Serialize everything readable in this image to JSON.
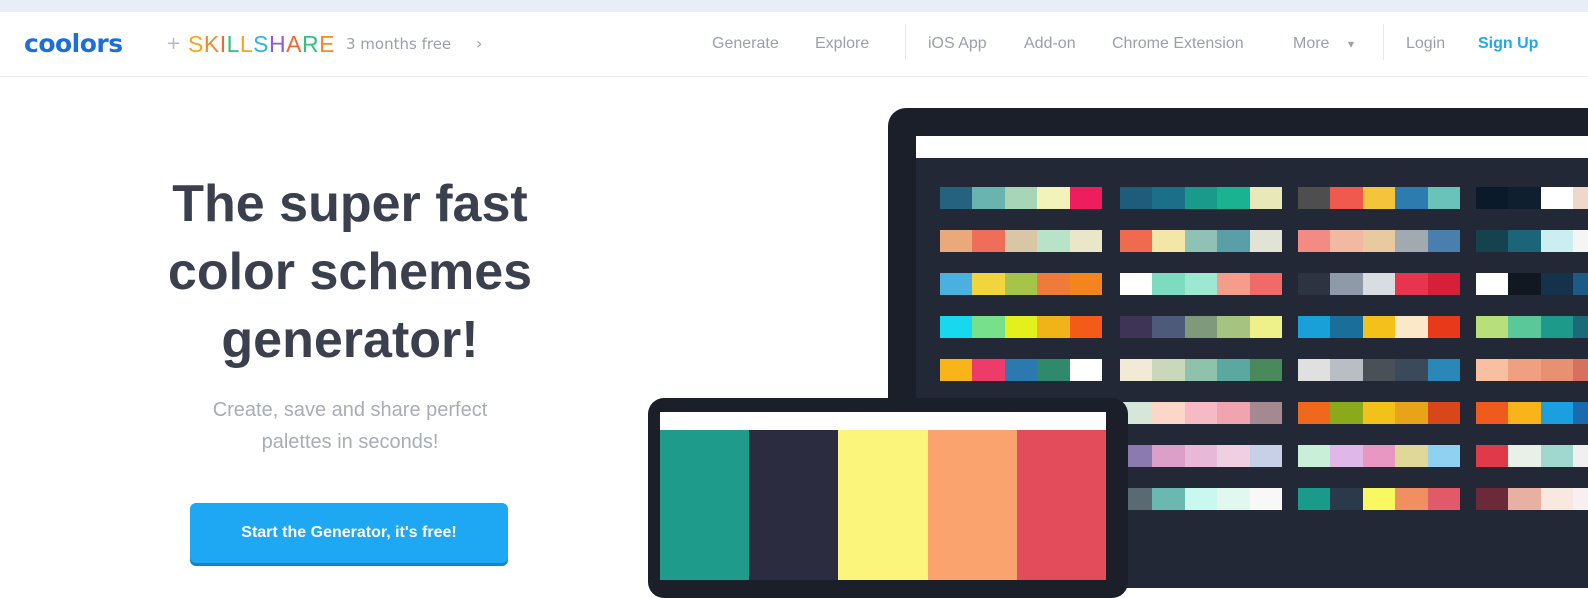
{
  "nav": {
    "logo": "coolors",
    "logo_color": "#1c6fd8",
    "plus": "+",
    "partner": {
      "letters": [
        "S",
        "K",
        "I",
        "L",
        "L",
        "S",
        "H",
        "A",
        "R",
        "E"
      ],
      "colors": [
        "#f7a51c",
        "#f48a26",
        "#f0682c",
        "#2ec47a",
        "#f7a51c",
        "#2db3e8",
        "#8e5cd6",
        "#f0682c",
        "#2ec47a",
        "#f48a26"
      ]
    },
    "promo": "3 months free",
    "promo_chevron": "›",
    "links": {
      "generate": "Generate",
      "explore": "Explore",
      "ios_app": "iOS App",
      "addon": "Add-on",
      "chrome": "Chrome Extension",
      "more": "More",
      "more_chevron": "▾",
      "login": "Login",
      "signup": "Sign Up"
    }
  },
  "hero": {
    "title_lines": [
      "The super fast",
      "color schemes",
      "generator!"
    ],
    "subtitle_lines": [
      "Create, save and share perfect",
      "palettes in seconds!"
    ],
    "cta": "Start the Generator, it's free!"
  },
  "monitor_palettes": [
    [
      [
        "#24627f",
        "#6ab4b0",
        "#a7d6b7",
        "#f2f2bb",
        "#ef1d5b"
      ],
      [
        "#1f5b7a",
        "#1c6f88",
        "#199a8a",
        "#19b391",
        "#e8e8b8"
      ],
      [
        "#4e4e4e",
        "#f05a4e",
        "#f6c43a",
        "#2d7cb0",
        "#69c3b8"
      ],
      [
        "#0b1a2a",
        "#101f30",
        "#ffffff",
        "#f0d7c8",
        "#f8c4b4"
      ]
    ],
    [
      [
        "#e9a97a",
        "#ef6e59",
        "#d9c6a7",
        "#b8e3c8",
        "#eae6c8"
      ],
      [
        "#ef6a4e",
        "#f2e7a6",
        "#8fc1b5",
        "#5a9fa7",
        "#e1e3d4"
      ],
      [
        "#f48a84",
        "#f2b8a0",
        "#e9c9a0",
        "#a0aab0",
        "#4a7fad"
      ],
      [
        "#14424f",
        "#1c6578",
        "#cbeef0",
        "#f5f5f5",
        "#e9e9e9"
      ]
    ],
    [
      [
        "#4ab0e0",
        "#f2d43c",
        "#a6c44a",
        "#ee7b3a",
        "#f4851c"
      ],
      [
        "#ffffff",
        "#7ddcc0",
        "#9ce8d0",
        "#f69c8a",
        "#f06a6a"
      ],
      [
        "#2e3342",
        "#8e9aa8",
        "#d9dde2",
        "#e8344e",
        "#d81f3a"
      ],
      [
        "#ffffff",
        "#111822",
        "#14324a",
        "#1e5a86",
        "#3a8fc8"
      ]
    ],
    [
      [
        "#18d8f0",
        "#76e08a",
        "#e2f01c",
        "#f0b418",
        "#f45a18"
      ],
      [
        "#3e3556",
        "#4e5a7a",
        "#7e9a7a",
        "#a6c480",
        "#eef08a"
      ],
      [
        "#1aa0d8",
        "#1a6e9a",
        "#f2c21a",
        "#fbe8c8",
        "#e83a1a"
      ],
      [
        "#b8e07a",
        "#5ac898",
        "#1e9a8a",
        "#1a6a7a",
        "#2a3a5a"
      ]
    ],
    [
      [
        "#f8b418",
        "#ee3c6a",
        "#2a7ab0",
        "#2e8a6a",
        "#ffffff"
      ],
      [
        "#f0ead6",
        "#c8d8b8",
        "#8ec2aa",
        "#5aa8a0",
        "#4a8a5a"
      ],
      [
        "#e0e0e0",
        "#b8bec4",
        "#4a5058",
        "#3a4a5a",
        "#2a88b8"
      ],
      [
        "#f8c0a0",
        "#f0a080",
        "#e89070",
        "#d87060",
        "#c05a50"
      ]
    ],
    [
      null,
      [
        "#d6e6d8",
        "#fad7c6",
        "#f6b9c6",
        "#f0a4b0",
        "#a48a90"
      ],
      [
        "#f0681c",
        "#8aaa1c",
        "#f2c21a",
        "#e8a418",
        "#d8461a"
      ],
      [
        "#f05a1c",
        "#f8b418",
        "#1aa0e0",
        "#1a6ab0",
        "#2a3a5a"
      ]
    ],
    [
      null,
      [
        "#8a7ab0",
        "#dca0c8",
        "#e8b8d8",
        "#f0d0e0",
        "#c8d0e8"
      ],
      [
        "#c8f0d8",
        "#e0b8e8",
        "#e898c0",
        "#e0d898",
        "#90d0f0"
      ],
      [
        "#e03a4a",
        "#e8f0e8",
        "#a0d8d0",
        "#f0f0f0",
        "#d0d8e0"
      ]
    ],
    [
      null,
      [
        "#5a6a72",
        "#6ab8b0",
        "#c8f8f0",
        "#e0f8f0",
        "#f8f8f8"
      ],
      [
        "#1a9a8a",
        "#2a3a4a",
        "#f8f860",
        "#f09060",
        "#e05a6a"
      ],
      [
        "#6a2a3a",
        "#e8b0a0",
        "#f8e8e0",
        "#f8f0f0",
        "#e0e0e0"
      ]
    ]
  ],
  "laptop_palette": [
    "#1e9b8a",
    "#2b2c40",
    "#fbf57c",
    "#fba36e",
    "#e34d5b"
  ]
}
